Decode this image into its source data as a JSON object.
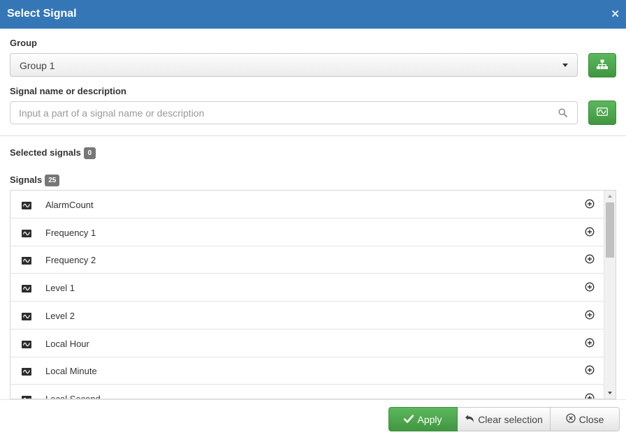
{
  "dialog": {
    "title": "Select Signal"
  },
  "group": {
    "label": "Group",
    "selected": "Group 1",
    "button_icon": "hierarchy-icon"
  },
  "search": {
    "label": "Signal name or description",
    "placeholder": "Input a part of a signal name or description",
    "value": "",
    "button_icon": "signal-wave-icon"
  },
  "selected": {
    "label": "Selected signals",
    "count": "0"
  },
  "signals": {
    "label": "Signals",
    "count": "25",
    "items": [
      {
        "name": "AlarmCount"
      },
      {
        "name": "Frequency 1"
      },
      {
        "name": "Frequency 2"
      },
      {
        "name": "Level 1"
      },
      {
        "name": "Level 2"
      },
      {
        "name": "Local Hour"
      },
      {
        "name": "Local Minute"
      },
      {
        "name": "Local Second"
      }
    ]
  },
  "footer": {
    "apply": "Apply",
    "clear": "Clear selection",
    "close": "Close"
  },
  "colors": {
    "header": "#3577b6",
    "green": "#5cb85c",
    "badge": "#777777"
  }
}
